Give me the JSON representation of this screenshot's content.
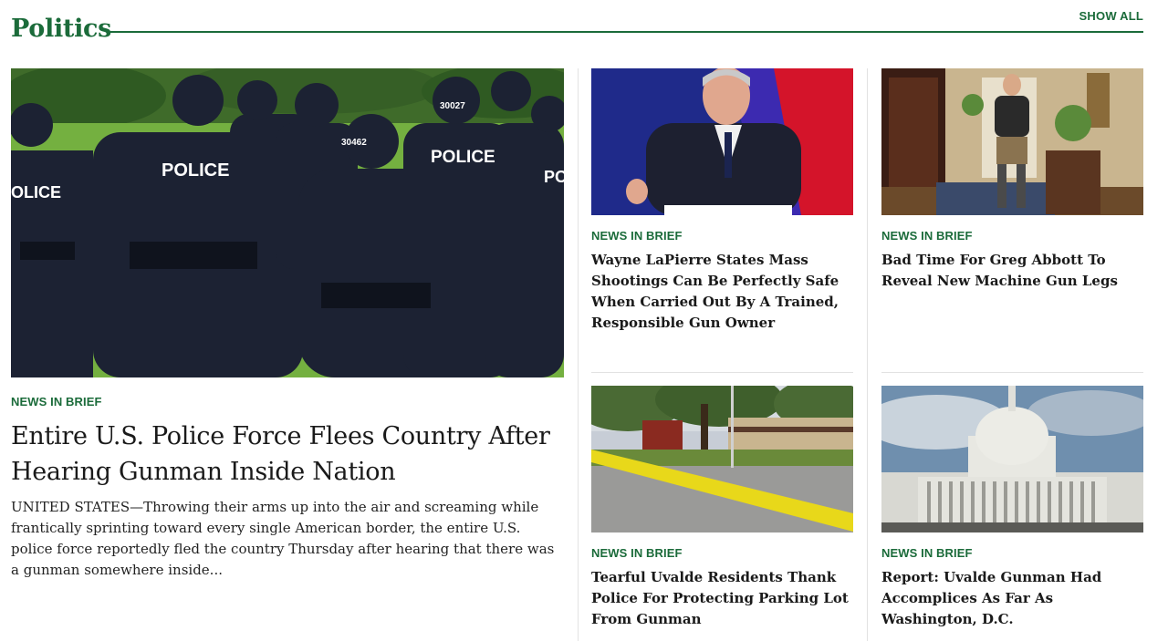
{
  "section": {
    "title": "Politics",
    "show_all_label": "SHOW ALL",
    "accent_color": "#1b6b3a"
  },
  "feature": {
    "tag": "NEWS IN BRIEF",
    "headline": "Entire U.S. Police Force Flees Country After Hearing Gunman Inside Nation",
    "summary": "UNITED STATES—Throwing their arms up into the air and screaming while frantically sprinting toward every single American border, the entire U.S. police force reportedly fled the country Thursday after hearing that there was a gunman somewhere inside..."
  },
  "articles": [
    {
      "tag": "NEWS IN BRIEF",
      "headline": "Wayne LaPierre States Mass Shootings Can Be Perfectly Safe When Carried Out By A Trained, Responsible Gun Owner"
    },
    {
      "tag": "NEWS IN BRIEF",
      "headline": "Bad Time For Greg Abbott To Reveal New Machine Gun Legs"
    },
    {
      "tag": "NEWS IN BRIEF",
      "headline": "Tearful Uvalde Residents Thank Police For Protecting Parking Lot From Gunman"
    },
    {
      "tag": "NEWS IN BRIEF",
      "headline": "Report: Uvalde Gunman Had Accomplices As Far As Washington, D.C."
    }
  ],
  "image_text": {
    "police_vest_1": "POLICE",
    "police_vest_2": "POLICE",
    "police_vest_3": "OLICE",
    "police_vest_4": "PO",
    "helmet_number": "30027",
    "helmet_number_2": "30462"
  }
}
